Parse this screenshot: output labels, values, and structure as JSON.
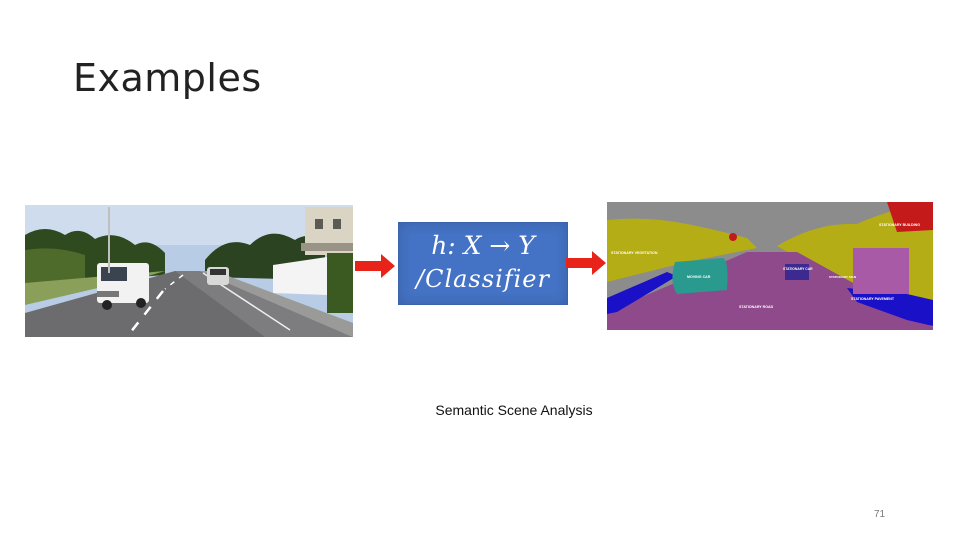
{
  "slide": {
    "title": "Examples",
    "caption": "Semantic Scene Analysis",
    "page_number": "71"
  },
  "classifier_box": {
    "line1": "h: X → Y",
    "line2": "/Classifier"
  },
  "segmentation_labels": {
    "vegetation": "STATIONARY VEGETATION",
    "building": "STATIONARY BUILDING",
    "moving_car": "MOVING CAR",
    "stationary_car": "STATIONARY CAR",
    "road": "STATIONARY ROAD",
    "pavement": "STATIONARY PAVEMENT",
    "other": "STATIONARY SIGN"
  },
  "colors": {
    "arrow": "#e8231a",
    "box": "#4472c4",
    "seg_sky": "#8c8c8c",
    "seg_vegetation": "#b5ad16",
    "seg_road": "#8e4a8a",
    "seg_car": "#2a9a8e",
    "seg_pavement": "#1a10c8",
    "seg_building": "#c41a1a"
  }
}
